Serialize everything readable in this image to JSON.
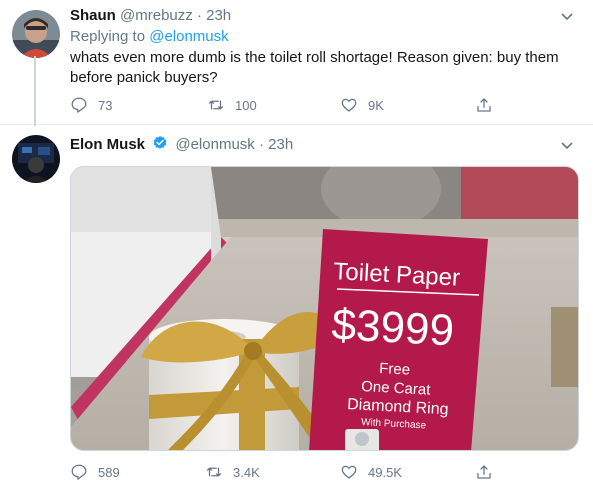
{
  "tweets": [
    {
      "name": "Shaun",
      "handle": "@mrebuzz",
      "separator": "·",
      "time": "23h",
      "replying_prefix": "Replying to",
      "replying_to": "@elonmusk",
      "text": "whats even more dumb is the toilet roll shortage! Reason given: buy them before panick buyers?",
      "actions": {
        "replies": "73",
        "retweets": "100",
        "likes": "9K"
      }
    },
    {
      "name": "Elon Musk",
      "handle": "@elonmusk",
      "separator": "·",
      "time": "23h",
      "verified": true,
      "media": {
        "sign_title": "Toilet Paper",
        "sign_price": "$3999",
        "sign_line1": "Free",
        "sign_line2": "One Carat",
        "sign_line3": "Diamond Ring",
        "sign_line4": "With Purchase"
      },
      "actions": {
        "replies": "589",
        "retweets": "3.4K",
        "likes": "49.5K"
      }
    }
  ],
  "icons": {
    "reply": "reply-icon",
    "retweet": "retweet-icon",
    "like": "like-icon",
    "share": "share-icon",
    "caret": "chevron-down-icon",
    "verified": "verified-badge-icon"
  },
  "colors": {
    "link": "#1da1f2",
    "secondary_text": "#657786",
    "primary_text": "#14171a",
    "divider": "#e6ecf0",
    "sign_red": "#b3194a"
  }
}
